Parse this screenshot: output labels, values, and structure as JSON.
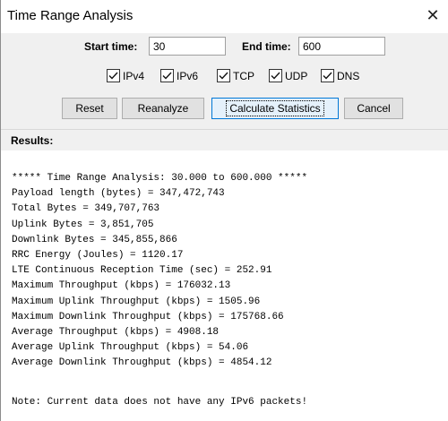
{
  "window": {
    "title": "Time Range Analysis",
    "close_glyph": "✕"
  },
  "range": {
    "start_label": "Start time:",
    "start_value": "30",
    "end_label": "End time:",
    "end_value": "600"
  },
  "filters": [
    {
      "label": "IPv4",
      "checked": true
    },
    {
      "label": "IPv6",
      "checked": true
    },
    {
      "label": "TCP",
      "checked": true
    },
    {
      "label": "UDP",
      "checked": true
    },
    {
      "label": "DNS",
      "checked": true
    }
  ],
  "buttons": {
    "reset": "Reset",
    "reanalyze": "Reanalyze",
    "calculate": "Calculate Statistics",
    "cancel": "Cancel"
  },
  "results": {
    "label": "Results:",
    "lines": [
      "***** Time Range Analysis: 30.000 to 600.000 *****",
      "Payload length (bytes) = 347,472,743",
      "Total Bytes = 349,707,763",
      "Uplink Bytes = 3,851,705",
      "Downlink Bytes = 345,855,866",
      "RRC Energy (Joules) = 1120.17",
      "LTE Continuous Reception Time (sec) = 252.91",
      "Maximum Throughput (kbps) = 176032.13",
      "Maximum Uplink Throughput (kbps) = 1505.96",
      "Maximum Downlink Throughput (kbps) = 175768.66",
      "Average Throughput (kbps) = 4908.18",
      "Average Uplink Throughput (kbps) = 54.06",
      "Average Downlink Throughput (kbps) = 4854.12"
    ],
    "note": "Note: Current data does not have any IPv6 packets!"
  }
}
